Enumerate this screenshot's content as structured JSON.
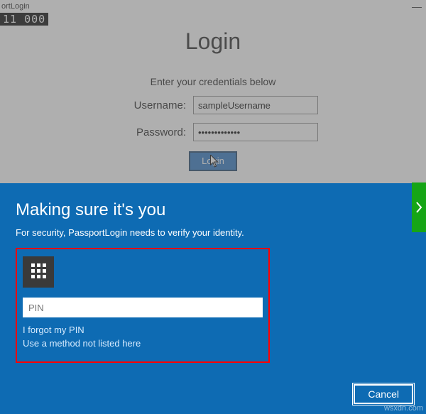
{
  "window": {
    "title": "ortLogin",
    "badge": "11  000",
    "minimize": "—"
  },
  "login": {
    "title": "Login",
    "subtitle": "Enter your credentials below",
    "username_label": "Username:",
    "username_value": "sampleUsername",
    "password_label": "Password:",
    "password_value": "•••••••••••••",
    "button": "Login"
  },
  "dialog": {
    "title": "Making sure it's you",
    "desc": "For security, PassportLogin needs to verify your identity.",
    "pin_placeholder": "PIN",
    "forgot": "I forgot my PIN",
    "other_method": "Use a method not listed here",
    "cancel": "Cancel"
  },
  "watermark": "wsxdn.com"
}
